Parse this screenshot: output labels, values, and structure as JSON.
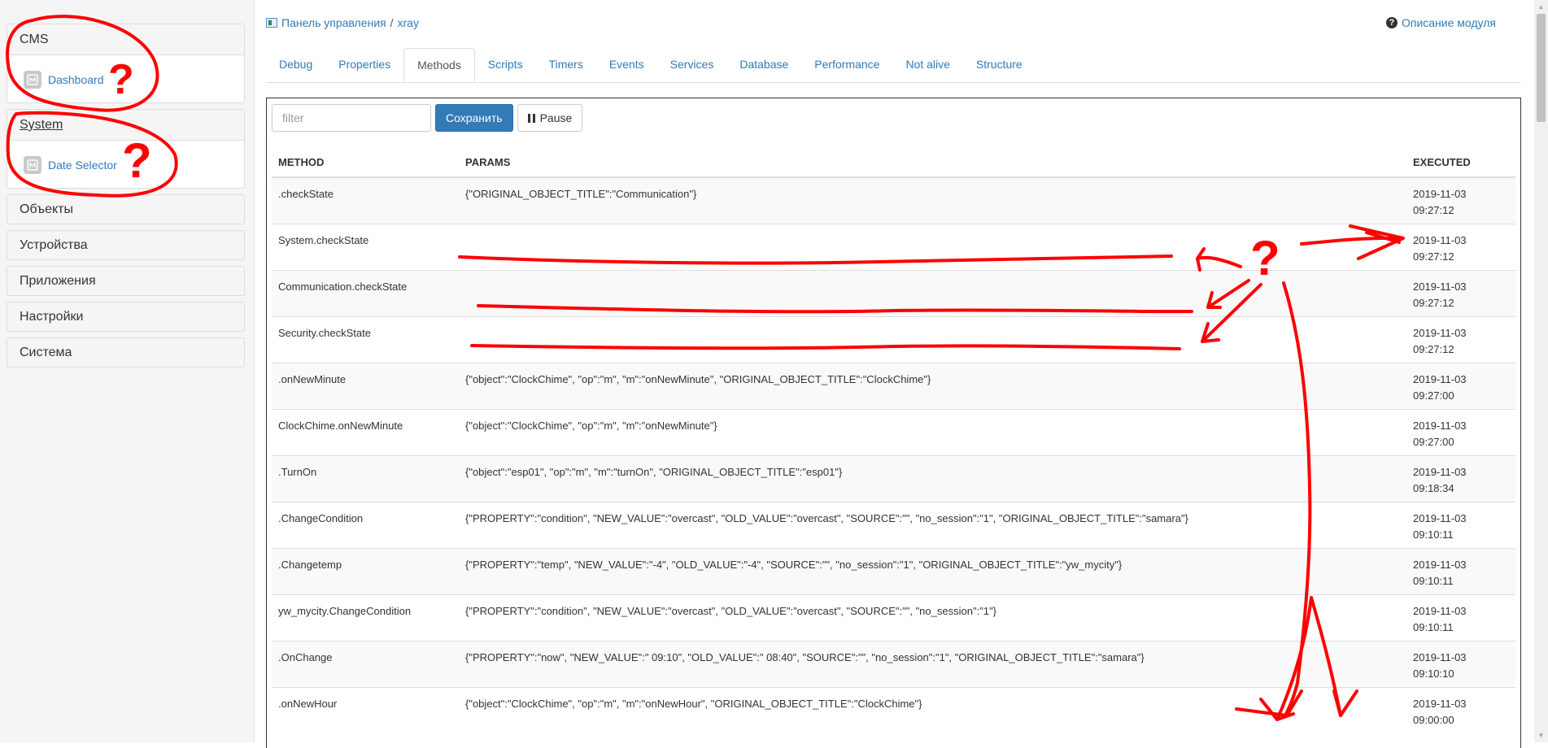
{
  "sidebar": {
    "panels": [
      {
        "title": "CMS",
        "module": "Dashboard"
      },
      {
        "title": "System",
        "module": "Date Selector"
      }
    ],
    "categories": [
      "Объекты",
      "Устройства",
      "Приложения",
      "Настройки",
      "Система"
    ]
  },
  "breadcrumb": {
    "root": "Панель управления",
    "separator": "/",
    "current": "xray"
  },
  "help": {
    "label": "Описание модуля"
  },
  "tabs": [
    "Debug",
    "Properties",
    "Methods",
    "Scripts",
    "Timers",
    "Events",
    "Services",
    "Database",
    "Performance",
    "Not alive",
    "Structure"
  ],
  "active_tab": "Methods",
  "toolbar": {
    "filter_placeholder": "filter",
    "save_label": "Сохранить",
    "pause_label": "Pause"
  },
  "table": {
    "headers": {
      "method": "METHOD",
      "params": "PARAMS",
      "executed": "EXECUTED"
    },
    "rows": [
      {
        "method": ".checkState",
        "params": "{\"ORIGINAL_OBJECT_TITLE\":\"Communication\"}",
        "date": "2019-11-03",
        "time": "09:27:12"
      },
      {
        "method": "System.checkState",
        "params": "",
        "date": "2019-11-03",
        "time": "09:27:12"
      },
      {
        "method": "Communication.checkState",
        "params": "",
        "date": "2019-11-03",
        "time": "09:27:12"
      },
      {
        "method": "Security.checkState",
        "params": "",
        "date": "2019-11-03",
        "time": "09:27:12"
      },
      {
        "method": ".onNewMinute",
        "params": "{\"object\":\"ClockChime\", \"op\":\"m\", \"m\":\"onNewMinute\", \"ORIGINAL_OBJECT_TITLE\":\"ClockChime\"}",
        "date": "2019-11-03",
        "time": "09:27:00"
      },
      {
        "method": "ClockChime.onNewMinute",
        "params": "{\"object\":\"ClockChime\", \"op\":\"m\", \"m\":\"onNewMinute\"}",
        "date": "2019-11-03",
        "time": "09:27:00"
      },
      {
        "method": ".TurnOn",
        "params": "{\"object\":\"esp01\", \"op\":\"m\", \"m\":\"turnOn\", \"ORIGINAL_OBJECT_TITLE\":\"esp01\"}",
        "date": "2019-11-03",
        "time": "09:18:34"
      },
      {
        "method": ".ChangeCondition",
        "params": "{\"PROPERTY\":\"condition\", \"NEW_VALUE\":\"overcast\", \"OLD_VALUE\":\"overcast\", \"SOURCE\":\"\", \"no_session\":\"1\", \"ORIGINAL_OBJECT_TITLE\":\"samara\"}",
        "date": "2019-11-03",
        "time": "09:10:11"
      },
      {
        "method": ".Changetemp",
        "params": "{\"PROPERTY\":\"temp\", \"NEW_VALUE\":\"-4\", \"OLD_VALUE\":\"-4\", \"SOURCE\":\"\", \"no_session\":\"1\", \"ORIGINAL_OBJECT_TITLE\":\"yw_mycity\"}",
        "date": "2019-11-03",
        "time": "09:10:11"
      },
      {
        "method": "yw_mycity.ChangeCondition",
        "params": "{\"PROPERTY\":\"condition\", \"NEW_VALUE\":\"overcast\", \"OLD_VALUE\":\"overcast\", \"SOURCE\":\"\", \"no_session\":\"1\"}",
        "date": "2019-11-03",
        "time": "09:10:11"
      },
      {
        "method": ".OnChange",
        "params": "{\"PROPERTY\":\"now\", \"NEW_VALUE\":\" 09:10\", \"OLD_VALUE\":\" 08:40\", \"SOURCE\":\"\", \"no_session\":\"1\", \"ORIGINAL_OBJECT_TITLE\":\"samara\"}",
        "date": "2019-11-03",
        "time": "09:10:10"
      },
      {
        "method": ".onNewHour",
        "params": "{\"object\":\"ClockChime\", \"op\":\"m\", \"m\":\"onNewHour\", \"ORIGINAL_OBJECT_TITLE\":\"ClockChime\"}",
        "date": "2019-11-03",
        "time": "09:00:00"
      }
    ]
  },
  "annotations": {
    "question_mark": "?",
    "color": "#ff0000"
  },
  "icons": {
    "module": "module-icon",
    "help": "question-circle-icon",
    "pause": "pause-icon",
    "breadcrumb": "control-panel-icon"
  }
}
